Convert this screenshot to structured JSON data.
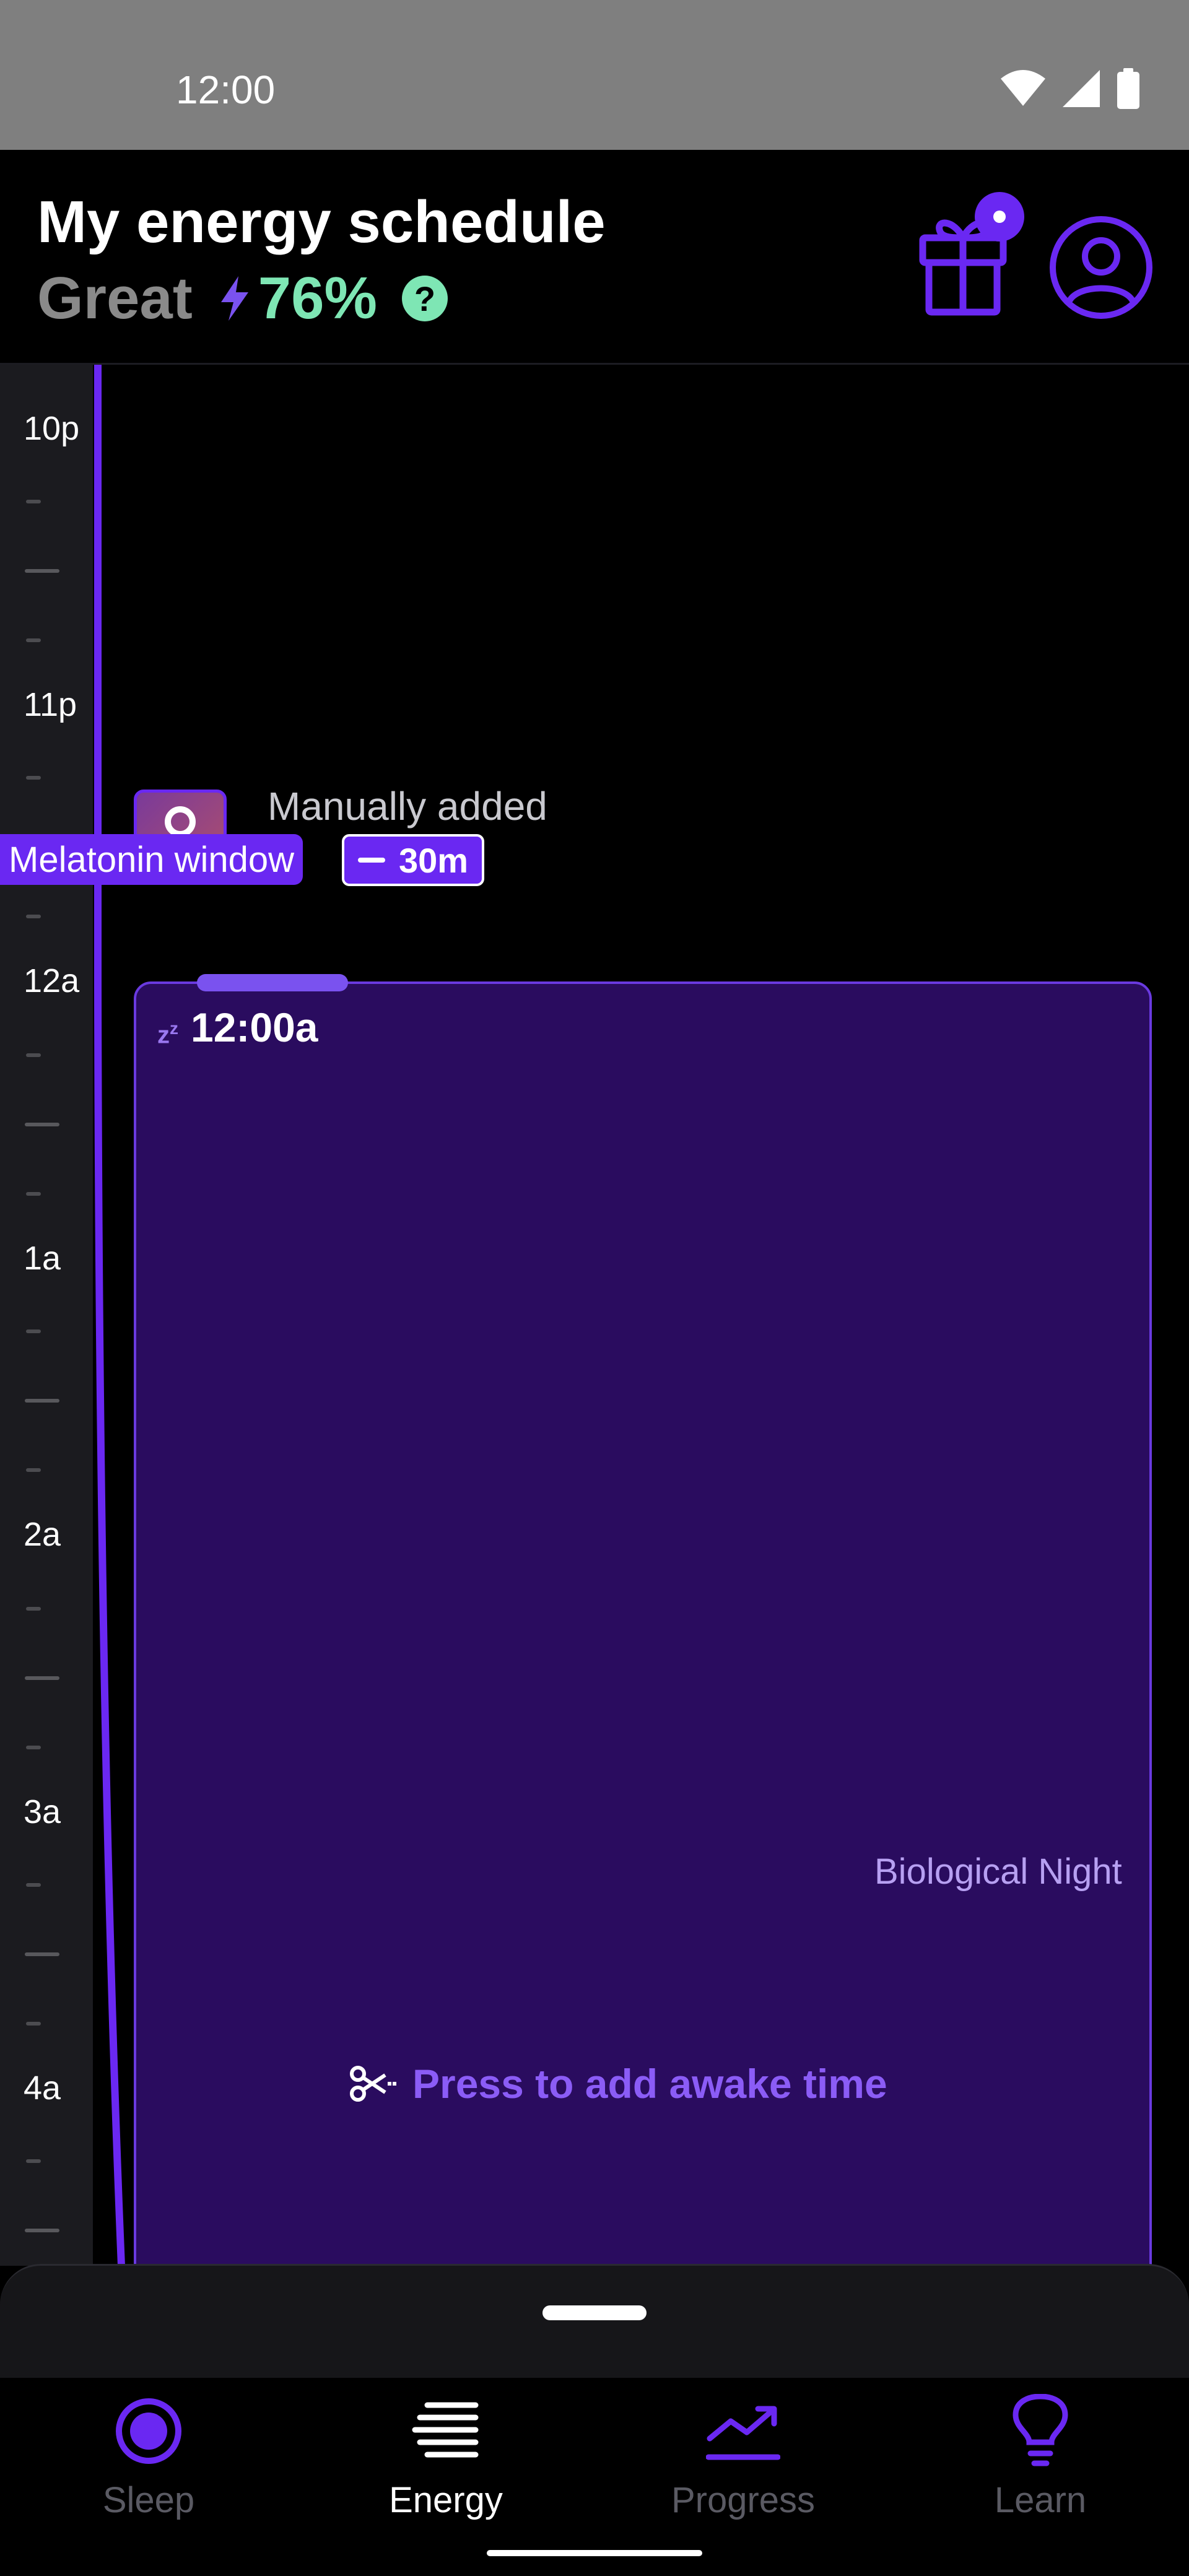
{
  "status_bar": {
    "time": "12:00",
    "icons": [
      "wifi-icon",
      "signal-icon",
      "battery-icon"
    ]
  },
  "header": {
    "title": "My energy schedule",
    "energy_label": "Great",
    "energy_percent": "76%",
    "help_symbol": "?",
    "icons": [
      "bolt-icon",
      "help-icon",
      "gift-icon",
      "profile-icon"
    ]
  },
  "timeline": {
    "hours": [
      "10p",
      "11p",
      "12a",
      "1a",
      "2a",
      "3a",
      "4a"
    ],
    "manual_entry": {
      "label": "Manually added",
      "tag": "Melatonin window",
      "duration": "30m"
    },
    "sleep_block": {
      "start_time": "12:00a",
      "zz": "z",
      "zz_sup": "z",
      "region_label": "Biological Night",
      "add_awake_label": "Press to add awake time"
    }
  },
  "bottom_nav": {
    "items": [
      {
        "label": "Sleep",
        "icon": "sleep-icon",
        "active": false
      },
      {
        "label": "Energy",
        "icon": "energy-list-icon",
        "active": true
      },
      {
        "label": "Progress",
        "icon": "progress-trend-icon",
        "active": false
      },
      {
        "label": "Learn",
        "icon": "lightbulb-icon",
        "active": false
      }
    ]
  },
  "colors": {
    "accent": "#6a28f2",
    "energy_green": "#7ee6b4",
    "sleep_block": "#2a0c5f",
    "inactive_nav": "#5a5a63"
  }
}
